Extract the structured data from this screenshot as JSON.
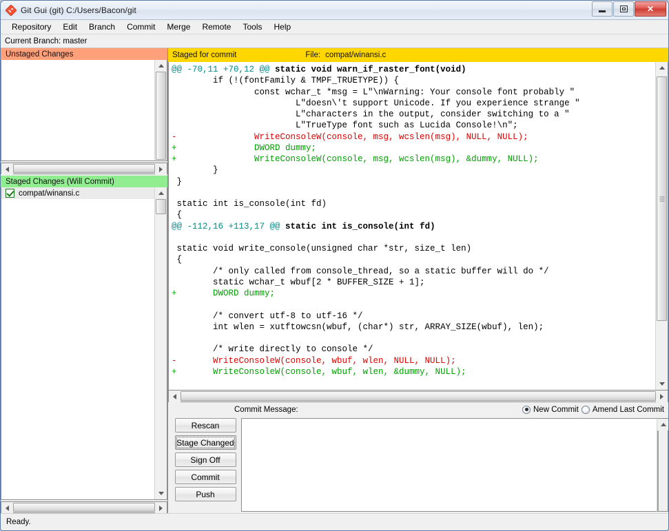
{
  "window": {
    "title": "Git Gui (git) C:/Users/Bacon/git",
    "icon": "git-logo-icon",
    "controls": {
      "minimize": "minimize",
      "maximize": "maximize",
      "close": "✕"
    }
  },
  "menubar": {
    "items": [
      {
        "label": "Repository"
      },
      {
        "label": "Edit"
      },
      {
        "label": "Branch"
      },
      {
        "label": "Commit"
      },
      {
        "label": "Merge"
      },
      {
        "label": "Remote"
      },
      {
        "label": "Tools"
      },
      {
        "label": "Help"
      }
    ]
  },
  "branch_bar": {
    "text": "Current Branch: master"
  },
  "left_panel": {
    "unstaged": {
      "header": "Unstaged Changes",
      "header_color": "#ffa07a",
      "files": []
    },
    "staged": {
      "header": "Staged Changes (Will Commit)",
      "header_color": "#90ee90",
      "files": [
        {
          "name": "compat/winansi.c",
          "icon": "staged-check-icon",
          "selected": true
        }
      ]
    }
  },
  "diff_panel": {
    "header_color": "#ffd700",
    "status": "Staged for commit",
    "file_label": "File:",
    "file_name": "compat/winansi.c",
    "lines": [
      {
        "type": "hunk",
        "marker": "@@ -70,11 +70,12 @@",
        "context": " static void warn_if_raster_font(void)"
      },
      {
        "type": "ctx",
        "text": "        if (!(fontFamily & TMPF_TRUETYPE)) {"
      },
      {
        "type": "ctx",
        "text": "                const wchar_t *msg = L\"\\nWarning: Your console font probably \""
      },
      {
        "type": "ctx",
        "text": "                        L\"doesn\\'t support Unicode. If you experience strange \""
      },
      {
        "type": "ctx",
        "text": "                        L\"characters in the output, consider switching to a \""
      },
      {
        "type": "ctx",
        "text": "                        L\"TrueType font such as Lucida Console!\\n\";"
      },
      {
        "type": "del",
        "text": "-               WriteConsoleW(console, msg, wcslen(msg), NULL, NULL);"
      },
      {
        "type": "add",
        "text": "+               DWORD dummy;"
      },
      {
        "type": "add",
        "text": "+               WriteConsoleW(console, msg, wcslen(msg), &dummy, NULL);"
      },
      {
        "type": "ctx",
        "text": "        }"
      },
      {
        "type": "ctx",
        "text": " }"
      },
      {
        "type": "ctx",
        "text": ""
      },
      {
        "type": "ctx",
        "text": " static int is_console(int fd)"
      },
      {
        "type": "ctx",
        "text": " {"
      },
      {
        "type": "hunk",
        "marker": "@@ -112,16 +113,17 @@",
        "context": " static int is_console(int fd)"
      },
      {
        "type": "ctx",
        "text": ""
      },
      {
        "type": "ctx",
        "text": " static void write_console(unsigned char *str, size_t len)"
      },
      {
        "type": "ctx",
        "text": " {"
      },
      {
        "type": "ctx",
        "text": "        /* only called from console_thread, so a static buffer will do */"
      },
      {
        "type": "ctx",
        "text": "        static wchar_t wbuf[2 * BUFFER_SIZE + 1];"
      },
      {
        "type": "add",
        "text": "+       DWORD dummy;"
      },
      {
        "type": "ctx",
        "text": ""
      },
      {
        "type": "ctx",
        "text": "        /* convert utf-8 to utf-16 */"
      },
      {
        "type": "ctx",
        "text": "        int wlen = xutftowcsn(wbuf, (char*) str, ARRAY_SIZE(wbuf), len);"
      },
      {
        "type": "ctx",
        "text": ""
      },
      {
        "type": "ctx",
        "text": "        /* write directly to console */"
      },
      {
        "type": "del",
        "text": "-       WriteConsoleW(console, wbuf, wlen, NULL, NULL);"
      },
      {
        "type": "add",
        "text": "+       WriteConsoleW(console, wbuf, wlen, &dummy, NULL);"
      }
    ]
  },
  "commit": {
    "message_label": "Commit Message:",
    "message_value": "",
    "message_placeholder": "",
    "commit_mode": {
      "new_commit": {
        "label": "New Commit",
        "selected": true
      },
      "amend_last_commit": {
        "label": "Amend Last Commit",
        "selected": false
      }
    },
    "buttons": [
      {
        "label": "Rescan",
        "focused": false
      },
      {
        "label": "Stage Changed",
        "focused": true
      },
      {
        "label": "Sign Off",
        "focused": false
      },
      {
        "label": "Commit",
        "focused": false
      },
      {
        "label": "Push",
        "focused": false
      }
    ]
  },
  "statusbar": {
    "text": "Ready."
  }
}
